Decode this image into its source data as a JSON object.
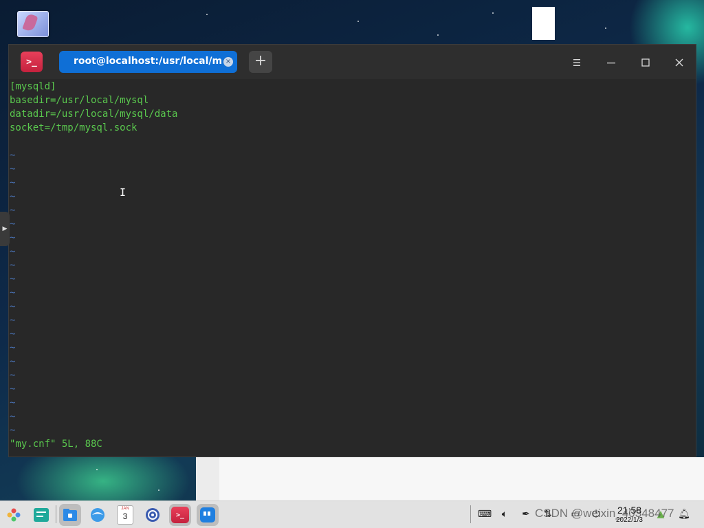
{
  "window": {
    "tab_title": "root@localhost:/usr/local/mysql",
    "tab_close": "×",
    "add_tab": "+"
  },
  "editor": {
    "lines": [
      "[mysqld]",
      "basedir=/usr/local/mysql",
      "datadir=/usr/local/mysql/data",
      "socket=/tmp/mysql.sock",
      ""
    ],
    "empty_marker": "~",
    "status_line": "\"my.cnf\" 5L, 88C"
  },
  "taskbar": {
    "calendar_month": "JAN",
    "calendar_day": "3",
    "clock_time": "21:58",
    "clock_date": "2022/1/3"
  },
  "watermark": "CSDN @weixin_40348477",
  "colors": {
    "terminal_bg": "#282828",
    "text_green": "#5ac84e",
    "tilde_blue": "#4a73b6",
    "tab_active": "#0f6fd6",
    "app_icon_red": "#d9304c"
  }
}
